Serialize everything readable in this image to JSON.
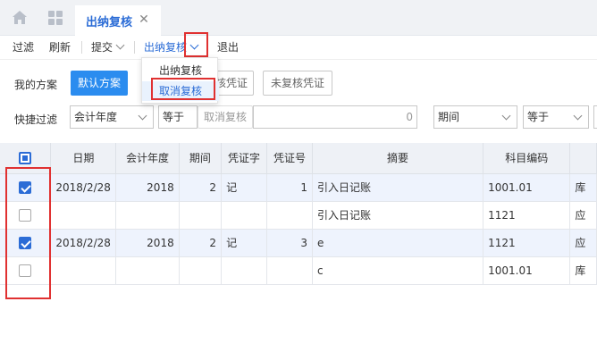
{
  "tabs": {
    "active_label": "出纳复核",
    "close_glyph": "✕"
  },
  "toolbar": {
    "filter": "过滤",
    "refresh": "刷新",
    "submit": "提交",
    "cashier_review": "出纳复核",
    "exit": "退出"
  },
  "dropdown": {
    "items": [
      {
        "label": "出纳复核",
        "selected": false
      },
      {
        "label": "取消复核",
        "selected": true
      }
    ]
  },
  "filter": {
    "my_scheme_label": "我的方案",
    "default_scheme": "默认方案",
    "scheme_btn_2": "核凭证",
    "unreviewed_voucher": "未复核凭证",
    "quick_filter_label": "快捷过滤",
    "field1": "会计年度",
    "op1": "等于",
    "cancel_review_text": "取消复核",
    "value1": "0",
    "field2": "期间",
    "op2": "等于"
  },
  "table": {
    "columns": [
      "日期",
      "会计年度",
      "期间",
      "凭证字",
      "凭证号",
      "摘要",
      "科目编码",
      ""
    ],
    "rows": [
      {
        "checked": true,
        "date": "2018/2/28",
        "year": "2018",
        "period": "2",
        "word": "记",
        "number": "1",
        "summary": "引入日记账",
        "account": "1001.01",
        "extra": "库"
      },
      {
        "checked": false,
        "date": "",
        "year": "",
        "period": "",
        "word": "",
        "number": "",
        "summary": "引入日记账",
        "account": "1121",
        "extra": "应"
      },
      {
        "checked": true,
        "date": "2018/2/28",
        "year": "2018",
        "period": "2",
        "word": "记",
        "number": "3",
        "summary": "e",
        "account": "1121",
        "extra": "应"
      },
      {
        "checked": false,
        "date": "",
        "year": "",
        "period": "",
        "word": "",
        "number": "",
        "summary": "c",
        "account": "1001.01",
        "extra": "库"
      }
    ]
  },
  "colors": {
    "accent": "#2b6cd6",
    "highlight_red": "#e03131",
    "primary_button": "#2b8cef"
  }
}
